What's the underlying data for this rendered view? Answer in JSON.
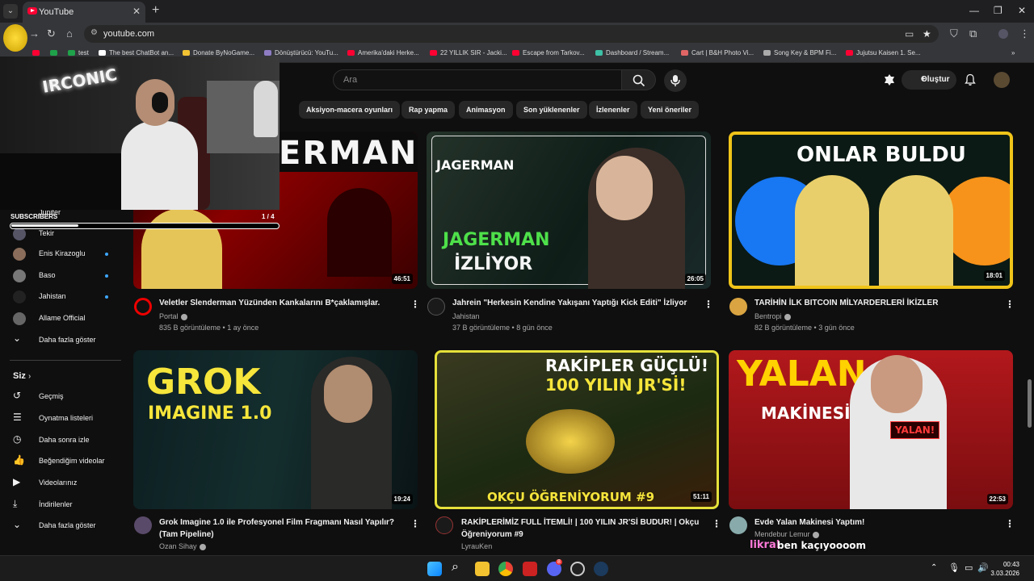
{
  "browser": {
    "tab_title": "YouTube",
    "url": "youtube.com",
    "bookmarks": [
      {
        "label": "test",
        "color": "#1fa24a"
      },
      {
        "label": "The best ChatBot an...",
        "color": "#ffffff"
      },
      {
        "label": "Donate ByNoGame...",
        "color": "#f1c232"
      },
      {
        "label": "Dönüştürücü: YouTu...",
        "color": "#8e7cc3"
      },
      {
        "label": "Amerika'daki Herke...",
        "color": "#ff0033"
      },
      {
        "label": "22 YILLIK SIR - Jacki...",
        "color": "#ff0033"
      },
      {
        "label": "Escape from Tarkov...",
        "color": "#ff0033"
      },
      {
        "label": "Dashboard / Stream...",
        "color": "#3ec1a6"
      },
      {
        "label": "Cart | B&H Photo Vi...",
        "color": "#e06666"
      },
      {
        "label": "Song Key & BPM Fi...",
        "color": "#aaaaaa"
      },
      {
        "label": "Jujutsu Kaisen 1. Se...",
        "color": "#ff0033"
      }
    ]
  },
  "youtube": {
    "search_placeholder": "Ara",
    "create_label": "Oluştur",
    "chips": [
      "Aksiyon-macera oyunları",
      "Rap yapma",
      "Animasyon",
      "Son yüklenenler",
      "İzlenenler",
      "Yeni öneriler"
    ],
    "sidebar": {
      "subs_partial": "Jupiter",
      "subscriptions": [
        {
          "label": "Tekir",
          "dot": false,
          "color": "#556"
        },
        {
          "label": "Enis Kirazoglu",
          "dot": true,
          "color": "#8a6d5a"
        },
        {
          "label": "Baso",
          "dot": true,
          "color": "#777"
        },
        {
          "label": "Jahistan",
          "dot": true,
          "color": "#222"
        },
        {
          "label": "Allame Official",
          "dot": false,
          "color": "#666"
        }
      ],
      "show_more": "Daha fazla göster",
      "you_heading": "Siz",
      "you_items": [
        {
          "label": "Geçmiş",
          "icon": "history-icon"
        },
        {
          "label": "Oynatma listeleri",
          "icon": "playlist-icon"
        },
        {
          "label": "Daha sonra izle",
          "icon": "clock-icon"
        },
        {
          "label": "Beğendiğim videolar",
          "icon": "thumb-up-icon"
        },
        {
          "label": "Videolarınız",
          "icon": "video-icon"
        },
        {
          "label": "İndirilenler",
          "icon": "download-icon"
        },
        {
          "label": "Daha fazla göster",
          "icon": "chevron-down-icon"
        }
      ]
    },
    "videos": [
      {
        "title": "Veletler Slenderman Yüzünden Kankalarını B*çaklamışlar.",
        "channel": "Portal",
        "meta": "835 B görüntüleme • 1 ay önce",
        "duration": "46:51",
        "thumb_text": "ERMAN"
      },
      {
        "title": "Jahrein \"Herkesin Kendine Yakışanı Yaptığı Kick Editi\" İzliyor",
        "channel": "Jahistan",
        "meta": "37 B görüntüleme • 8 gün önce",
        "duration": "26:05",
        "thumb_text": "JAGERMAN",
        "thumb_text2": "İZLİYOR",
        "thumb_logo": "JAGERMAN"
      },
      {
        "title": "TARİHİN İLK BITCOIN MİLYARDERLERİ İKİZLER",
        "channel": "Bentropi",
        "meta": "82 B görüntüleme • 3 gün önce",
        "duration": "18:01",
        "thumb_text": "ONLAR BULDU"
      },
      {
        "title": "Grok Imagine 1.0 ile Profesyonel Film Fragmanı Nasıl Yapılır? (Tam Pipeline)",
        "channel": "Ozan Sihay",
        "meta": "",
        "duration": "19:24",
        "thumb_text": "GROK",
        "thumb_text2": "IMAGINE 1.0"
      },
      {
        "title": "RAKİPLERİMİZ FULL İTEMLİ! | 100 YILIN JR'Sİ BUDUR! | Okçu Öğreniyorum #9",
        "channel": "LyrauKen",
        "meta": "",
        "duration": "51:11",
        "thumb_text": "RAKİPLER GÜÇLÜ!",
        "thumb_text2": "100 YILIN JR'Sİ!",
        "thumb_text3": "OKÇU ÖĞRENİYORUM #9"
      },
      {
        "title": "Evde Yalan Makinesi Yaptım!",
        "channel": "Mendebur Lemur",
        "meta": "",
        "duration": "22:53",
        "thumb_text": "YALAN",
        "thumb_text2": "MAKİNESİ",
        "thumb_text3": "YALAN!"
      }
    ]
  },
  "stream_overlay": {
    "logo_text": "IRCONIC",
    "subs_label": "SUBSCRIBERS",
    "subs_count": "1 / 4",
    "subs_progress": 0.25,
    "chat_user": "likral",
    "chat_msg": "ben kaçıyoooom"
  },
  "taskbar": {
    "time": "00:43",
    "date": "3.03.2026",
    "badge": "8"
  }
}
